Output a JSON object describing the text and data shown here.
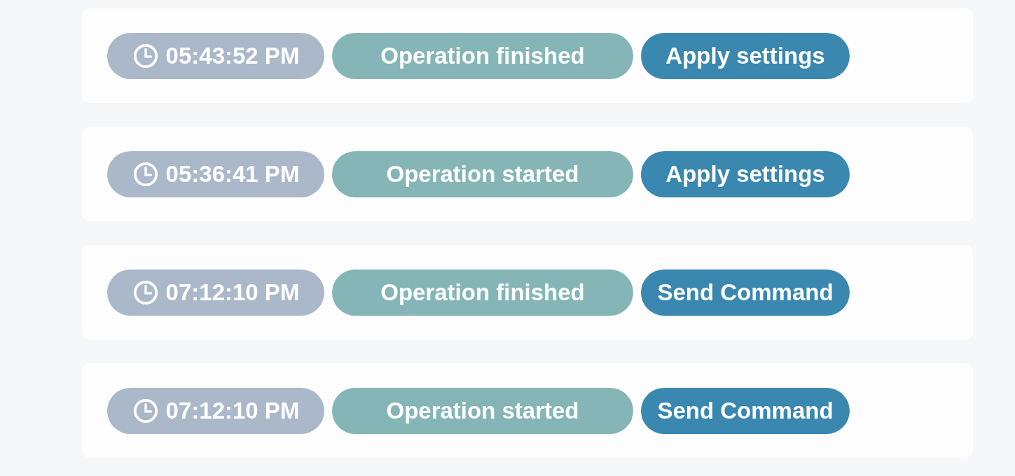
{
  "entries": [
    {
      "time": "05:43:52 PM",
      "status": "Operation finished",
      "action": "Apply settings"
    },
    {
      "time": "05:36:41 PM",
      "status": "Operation started",
      "action": "Apply settings"
    },
    {
      "time": "07:12:10 PM",
      "status": "Operation finished",
      "action": "Send Command"
    },
    {
      "time": "07:12:10 PM",
      "status": "Operation started",
      "action": "Send Command"
    }
  ]
}
